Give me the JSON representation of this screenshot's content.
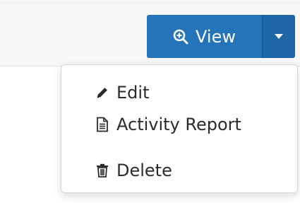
{
  "button_group": {
    "view_label": "View",
    "view_icon": "zoom-in-icon",
    "toggle_icon": "caret-down-icon",
    "accent_color": "#2574ba"
  },
  "menu": {
    "items": [
      {
        "label": "Edit",
        "icon": "pencil-icon"
      },
      {
        "label": "Activity Report",
        "icon": "document-icon"
      },
      {
        "label": "Delete",
        "icon": "trash-icon"
      }
    ]
  }
}
